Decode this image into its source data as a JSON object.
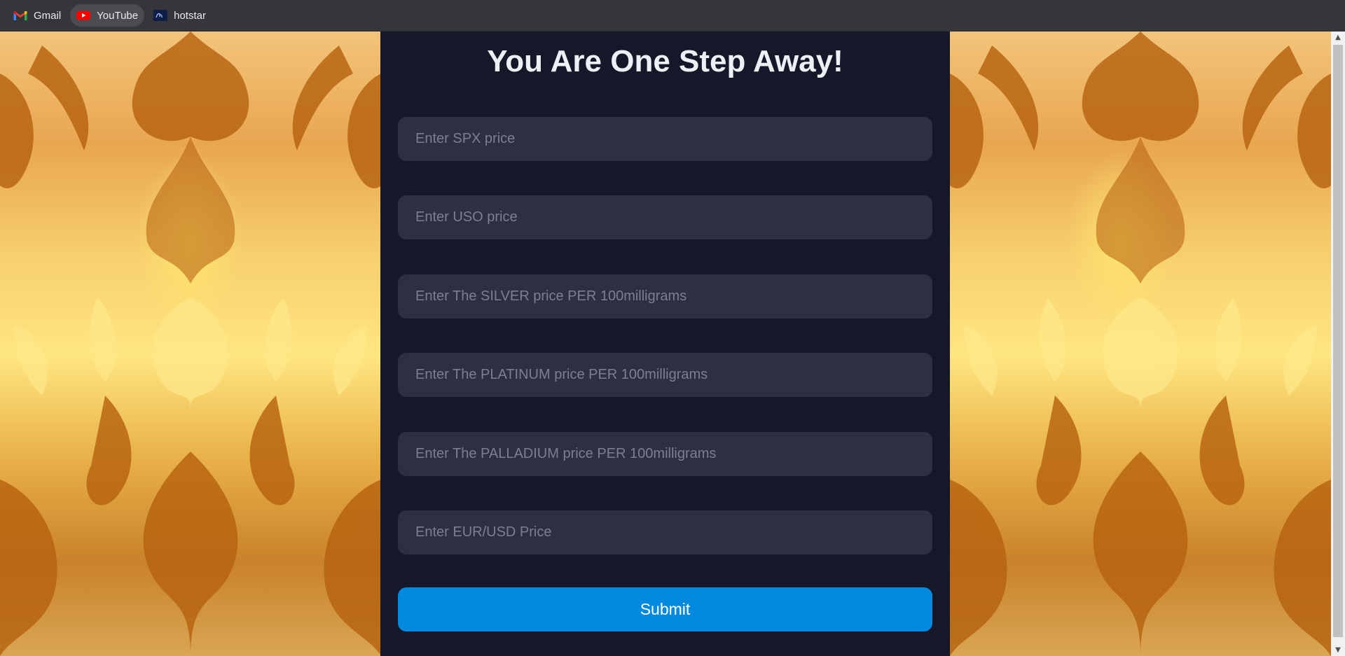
{
  "bookmarks": [
    {
      "label": "Gmail",
      "icon": "gmail-icon"
    },
    {
      "label": "YouTube",
      "icon": "youtube-icon"
    },
    {
      "label": "hotstar",
      "icon": "hotstar-icon"
    }
  ],
  "form": {
    "title": "You Are One Step Away!",
    "fields": [
      {
        "placeholder": "Enter SPX price",
        "value": ""
      },
      {
        "placeholder": "Enter USO price",
        "value": ""
      },
      {
        "placeholder": "Enter The SILVER price PER 100milligrams",
        "value": ""
      },
      {
        "placeholder": "Enter The PLATINUM price PER 100milligrams",
        "value": ""
      },
      {
        "placeholder": "Enter The PALLADIUM price PER 100milligrams",
        "value": ""
      },
      {
        "placeholder": "Enter EUR/USD Price",
        "value": ""
      }
    ],
    "submit_label": "Submit"
  },
  "colors": {
    "panel_background": "#151829",
    "field_background": "#2d3043",
    "submit_button": "#0089de",
    "background_gold": "#e9b149"
  }
}
